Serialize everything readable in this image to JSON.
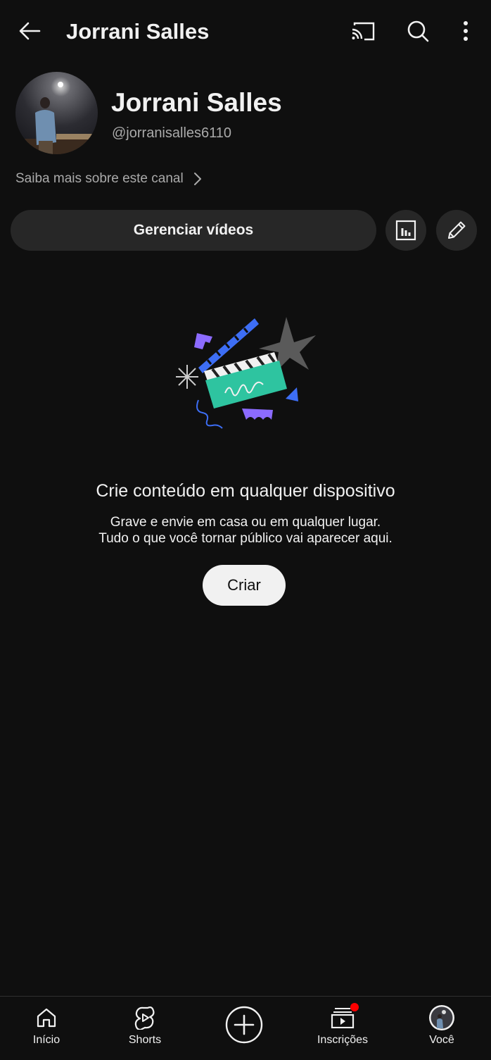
{
  "header": {
    "title": "Jorrani Salles",
    "back_icon": "arrow-left-icon",
    "cast_icon": "cast-icon",
    "search_icon": "search-icon",
    "more_icon": "more-vertical-icon"
  },
  "channel": {
    "name": "Jorrani Salles",
    "handle": "@jorranisalles6110",
    "about_link": "Saiba mais sobre este canal"
  },
  "actions": {
    "manage_label": "Gerenciar vídeos",
    "analytics_icon": "analytics-icon",
    "edit_icon": "pencil-icon"
  },
  "empty_state": {
    "illustration": "clapperboard-illustration",
    "title": "Crie conteúdo em qualquer dispositivo",
    "desc_line1": "Grave e envie em casa ou em qualquer lugar.",
    "desc_line2": "Tudo o que você tornar público vai aparecer aqui.",
    "create_label": "Criar"
  },
  "bottom_nav": {
    "home": "Início",
    "shorts": "Shorts",
    "subscriptions": "Inscrições",
    "you": "Você"
  },
  "colors": {
    "background": "#0f0f0f",
    "surface": "#272727",
    "text_primary": "#f1f1f1",
    "text_secondary": "#aaaaaa",
    "notification": "#ff0000"
  }
}
